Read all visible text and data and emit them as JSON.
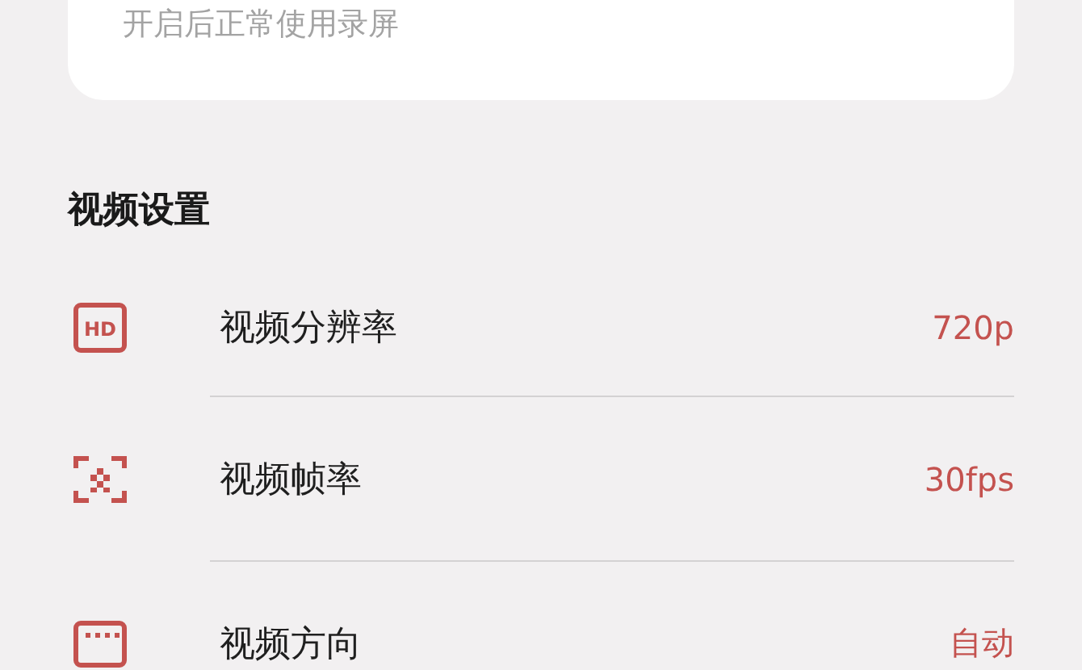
{
  "card": {
    "subtitle": "开启后正常使用录屏"
  },
  "section": {
    "title": "视频设置"
  },
  "rows": [
    {
      "kind": "hd",
      "icon_text": "HD",
      "label": "视频分辨率",
      "value": "720p"
    },
    {
      "kind": "frame",
      "label": "视频帧率",
      "value": "30fps"
    },
    {
      "kind": "screen",
      "label": "视频方向",
      "value": "自动"
    }
  ]
}
